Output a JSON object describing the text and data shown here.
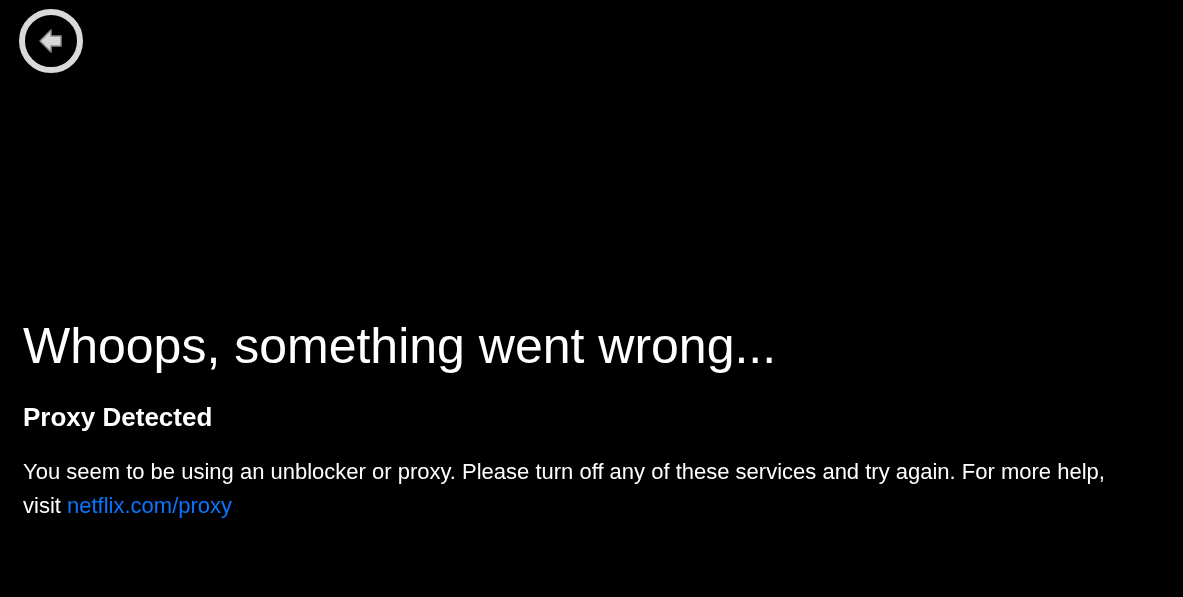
{
  "back_button": {
    "kind": "back"
  },
  "title": "Whoops, something went wrong...",
  "subtitle": "Proxy Detected",
  "message": {
    "text": "You seem to be using an unblocker or proxy. Please turn off any of these services and try again. For more help, visit",
    "link": "netflix.com/proxy"
  }
}
